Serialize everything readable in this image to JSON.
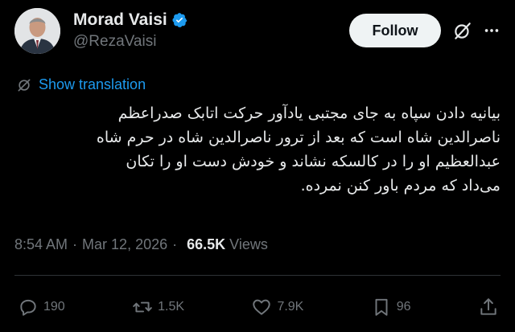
{
  "author": {
    "display_name": "Morad Vaisi",
    "handle": "@RezaVaisi",
    "verified": true
  },
  "header": {
    "follow_label": "Follow",
    "icons": [
      "grok-icon",
      "more-icon"
    ]
  },
  "translation": {
    "label": "Show translation"
  },
  "tweet": {
    "lines": [
      "بیانیه دادن سپاه به جای مجتبی یادآور حرکت اتابک صدراعظم",
      "ناصرالدین شاه است که بعد از ترور ناصرالدین شاه در حرم شاه",
      "عبدالعظیم او را در کالسکه نشاند و خودش دست او را تکان",
      "می‌داد که مردم باور کنن نمرده."
    ]
  },
  "meta": {
    "time": "8:54 AM",
    "date": "Mar 12, 2026",
    "views_count": "66.5K",
    "views_label": "Views"
  },
  "actions": {
    "replies": "190",
    "reposts": "1.5K",
    "likes": "7.9K",
    "bookmarks": "96"
  },
  "colors": {
    "background": "#000000",
    "accent": "#1d9bf0",
    "text": "#e7e9ea",
    "muted": "#71767b"
  }
}
